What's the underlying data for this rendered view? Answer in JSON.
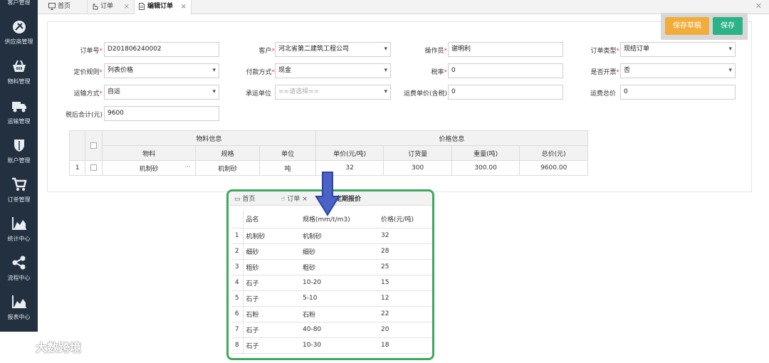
{
  "sidebar": {
    "items": [
      {
        "label": "客户管理",
        "icon": "user-icon"
      },
      {
        "label": "供应商管理",
        "icon": "supplier-icon"
      },
      {
        "label": "物料管理",
        "icon": "basket-icon"
      },
      {
        "label": "运输管理",
        "icon": "truck-icon"
      },
      {
        "label": "账户管理",
        "icon": "shield-icon"
      },
      {
        "label": "订单管理",
        "icon": "cart-icon"
      },
      {
        "label": "统计中心",
        "icon": "area-chart-icon"
      },
      {
        "label": "流程中心",
        "icon": "share-icon"
      },
      {
        "label": "报表中心",
        "icon": "report-chart-icon"
      }
    ]
  },
  "tabs": [
    {
      "label": "首页",
      "icon": "monitor-icon"
    },
    {
      "label": "订单",
      "icon": "hand-icon",
      "close": "×"
    },
    {
      "label": "编辑订单",
      "icon": "document-icon",
      "close": "×"
    }
  ],
  "window_close": "✕",
  "toolbar": {
    "draft_label": "保存草稿",
    "save_label": "保存"
  },
  "form": {
    "order_no": {
      "label": "订单号",
      "value": "D201806240002"
    },
    "customer": {
      "label": "客户",
      "value": "河北省第二建筑工程公司"
    },
    "operator": {
      "label": "操作员",
      "value": "谢明利"
    },
    "order_type": {
      "label": "订单类型",
      "value": "现结订单"
    },
    "pricing_rule": {
      "label": "定价规则",
      "value": "列表价格"
    },
    "payment": {
      "label": "付款方式",
      "value": "现金"
    },
    "tax_rate": {
      "label": "税率",
      "value": "0"
    },
    "invoice": {
      "label": "是否开票",
      "value": "否"
    },
    "transport": {
      "label": "运输方式",
      "value": "自运"
    },
    "carrier": {
      "label": "承运单位",
      "placeholder": "==请选择=="
    },
    "freight_unit": {
      "label": "运费单价(含税)",
      "value": "0"
    },
    "freight_total": {
      "label": "运费总价",
      "value": "0"
    },
    "total_after_tax": {
      "label": "税后合计(元)",
      "value": "9600"
    }
  },
  "grid": {
    "group_material": "物料信息",
    "group_price": "价格信息",
    "columns": [
      "物料",
      "规格",
      "单位",
      "单价(元/吨)",
      "订货量",
      "重量(吨)",
      "总价(元)"
    ],
    "rows": [
      {
        "index": "1",
        "material": "机制砂",
        "ellipsis": "···",
        "spec": "机制砂",
        "unit": "吨",
        "unit_price": "32",
        "quantity": "300",
        "weight": "300.00",
        "total": "9600.00"
      }
    ]
  },
  "overlay": {
    "tabs": [
      "首页",
      "订单",
      "定期报价"
    ],
    "columns": [
      "品名",
      "规格(mm/t/m3)",
      "价格(元/吨)"
    ],
    "rows": [
      {
        "n": "1",
        "name": "机制砂",
        "spec": "机制砂",
        "price": "32"
      },
      {
        "n": "2",
        "name": "细砂",
        "spec": "细砂",
        "price": "28"
      },
      {
        "n": "3",
        "name": "粗砂",
        "spec": "粗砂",
        "price": "25"
      },
      {
        "n": "4",
        "name": "石子",
        "spec": "10-20",
        "price": "15"
      },
      {
        "n": "5",
        "name": "石子",
        "spec": "5-10",
        "price": "12"
      },
      {
        "n": "6",
        "name": "石粉",
        "spec": "石粉",
        "price": "22"
      },
      {
        "n": "7",
        "name": "石子",
        "spec": "40-80",
        "price": "20"
      },
      {
        "n": "8",
        "name": "石子",
        "spec": "10-30",
        "price": "18"
      }
    ]
  },
  "watermark": {
    "text": "大数跨境"
  },
  "colors": {
    "sidebar": "#23303f",
    "draft_button": "#f0ad3c",
    "save_button": "#2bb287",
    "overlay_border": "#3fa85b",
    "arrow": "#4a63c8"
  }
}
